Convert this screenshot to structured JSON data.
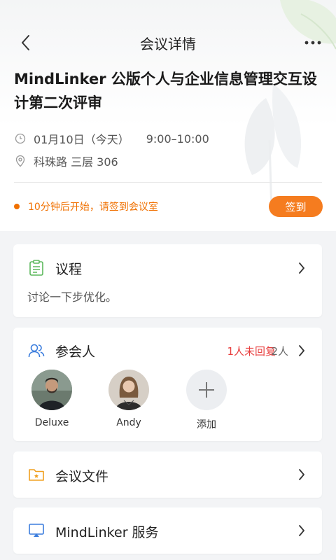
{
  "header": {
    "title": "会议详情"
  },
  "meeting": {
    "title": "MindLinker 公版个人与企业信息管理交互设计第二次评审",
    "date": "01月10日（今天）",
    "time": "9:00–10:00",
    "location": "科珠路 三层 306"
  },
  "notice": {
    "text": "10分钟后开始，请签到会议室",
    "button": "签到"
  },
  "agenda": {
    "title": "议程",
    "desc": "讨论一下步优化。"
  },
  "attendees": {
    "title": "参会人",
    "unreplied": "1人未回复",
    "count": "2人",
    "people": [
      {
        "name": "Deluxe"
      },
      {
        "name": "Andy"
      }
    ],
    "add_label": "添加"
  },
  "files": {
    "title": "会议文件"
  },
  "service": {
    "title": "MindLinker 服务"
  },
  "colors": {
    "accent": "#f57c1f",
    "alert": "#e83f3f"
  },
  "icons": {
    "back": "chevron-left-icon",
    "more": "more-horizontal-icon",
    "clock": "clock-icon",
    "location": "location-pin-icon",
    "agenda": "clipboard-icon",
    "attendees": "people-icon",
    "files": "folder-icon",
    "service": "screen-share-icon",
    "add": "plus-icon"
  }
}
